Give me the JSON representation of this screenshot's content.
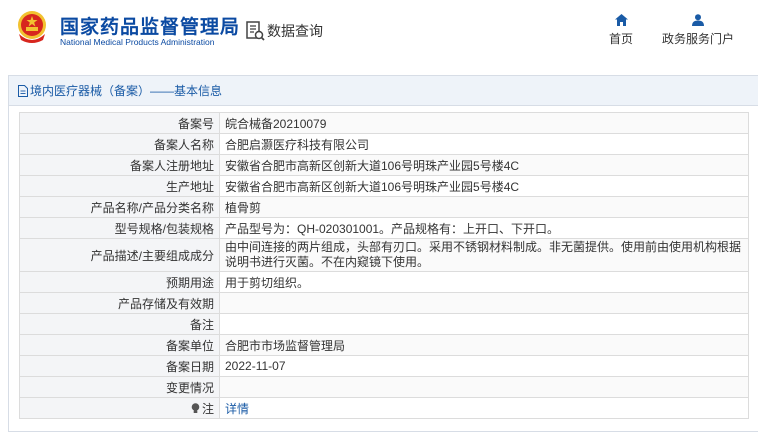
{
  "header": {
    "cn_title": "国家药品监督管理局",
    "en_title": "National Medical Products Administration",
    "query_label": "数据查询",
    "nav": [
      {
        "label": "首页",
        "icon": "home-icon"
      },
      {
        "label": "政务服务门户",
        "icon": "user-icon"
      }
    ]
  },
  "panel": {
    "title": "境内医疗器械（备案）——基本信息"
  },
  "rows": [
    {
      "label": "备案号",
      "value": "皖合械备20210079"
    },
    {
      "label": "备案人名称",
      "value": "合肥启灏医疗科技有限公司"
    },
    {
      "label": "备案人注册地址",
      "value": "安徽省合肥市高新区创新大道106号明珠产业园5号楼4C"
    },
    {
      "label": "生产地址",
      "value": "安徽省合肥市高新区创新大道106号明珠产业园5号楼4C"
    },
    {
      "label": "产品名称/产品分类名称",
      "value": "植骨剪"
    },
    {
      "label": "型号规格/包装规格",
      "value": "产品型号为：QH-020301001。产品规格有：上开口、下开口。"
    },
    {
      "label": "产品描述/主要组成成分",
      "value": "由中间连接的两片组成，头部有刃口。采用不锈钢材料制成。非无菌提供。使用前由使用机构根据说明书进行灭菌。不在内窥镜下使用。"
    },
    {
      "label": "预期用途",
      "value": "用于剪切组织。"
    },
    {
      "label": "产品存储及有效期",
      "value": ""
    },
    {
      "label": "备注",
      "value": ""
    },
    {
      "label": "备案单位",
      "value": "合肥市市场监督管理局"
    },
    {
      "label": "备案日期",
      "value": "2022-11-07"
    },
    {
      "label": "变更情况",
      "value": ""
    },
    {
      "label": "注",
      "value": "详情"
    }
  ],
  "colors": {
    "brand_blue": "#0b4aa2",
    "link_blue": "#1a5ba6",
    "emblem_red": "#d7261e",
    "emblem_gold": "#f2c230"
  }
}
